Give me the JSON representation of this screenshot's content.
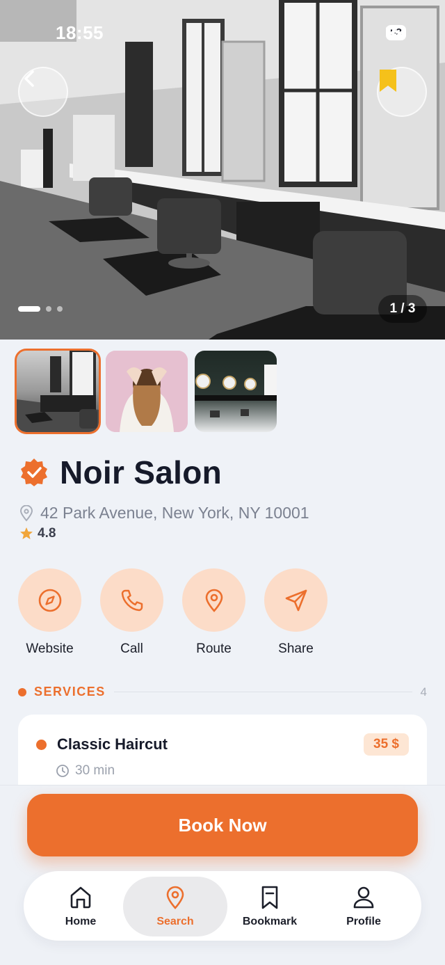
{
  "status_bar": {
    "time": "18:55",
    "battery": "93"
  },
  "hero": {
    "counter": "1 / 3",
    "dot_count": 3,
    "active_dot": 0
  },
  "salon": {
    "name": "Noir Salon",
    "address": "42 Park Avenue, New York, NY 10001",
    "rating": "4.8"
  },
  "actions": [
    {
      "label": "Website",
      "icon": "compass-icon"
    },
    {
      "label": "Call",
      "icon": "phone-icon"
    },
    {
      "label": "Route",
      "icon": "map-pin-icon"
    },
    {
      "label": "Share",
      "icon": "send-icon"
    }
  ],
  "services": {
    "title": "SERVICES",
    "count": "4",
    "items": [
      {
        "name": "Classic Haircut",
        "price": "35 $",
        "duration": "30 min"
      }
    ]
  },
  "cta": {
    "label": "Book Now"
  },
  "tabs": [
    {
      "label": "Home",
      "icon": "home-icon",
      "active": false
    },
    {
      "label": "Search",
      "icon": "map-pin-icon",
      "active": true
    },
    {
      "label": "Bookmark",
      "icon": "bookmark-icon",
      "active": false
    },
    {
      "label": "Profile",
      "icon": "user-icon",
      "active": false
    }
  ],
  "colors": {
    "accent": "#ec6f2d",
    "accent_soft": "#fcdcc8",
    "bookmark": "#f5c11a",
    "background": "#eff2f7"
  }
}
